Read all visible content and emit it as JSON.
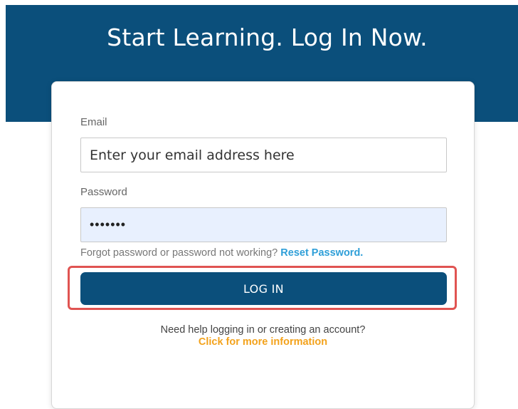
{
  "hero": {
    "title": "Start Learning. Log In Now.",
    "background_color": "#0b4f7b"
  },
  "login_form": {
    "email": {
      "label": "Email",
      "placeholder": "Enter your email address here",
      "value": ""
    },
    "password": {
      "label": "Password",
      "value": "•••••••"
    },
    "forgot": {
      "text": "Forgot password or password not working?",
      "link_label": "Reset Password."
    },
    "submit_label": "LOG IN",
    "help": {
      "text": "Need help logging in or creating an account?",
      "link_label": "Click for more information"
    }
  },
  "colors": {
    "primary": "#0b4f7b",
    "link_blue": "#2f9fd8",
    "link_orange": "#f3a21b",
    "highlight_red": "#e05452",
    "autofill_blue": "#e8f0fe"
  }
}
